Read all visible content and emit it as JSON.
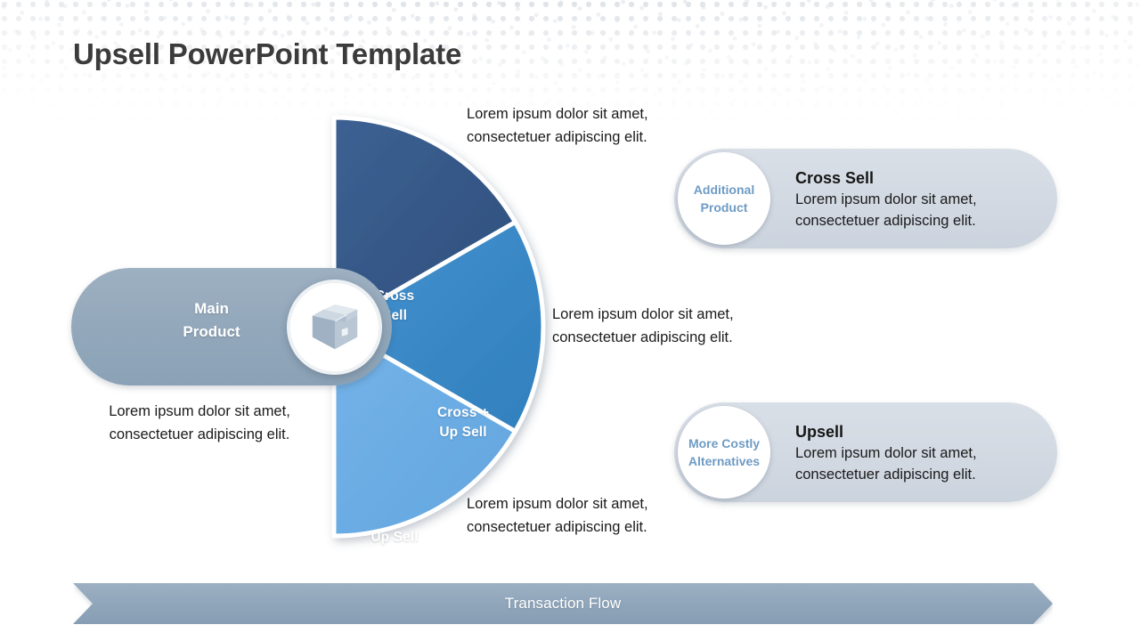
{
  "slide": {
    "title": "Upsell PowerPoint Template",
    "background_pattern": "halftone-dots",
    "colors": {
      "accent_dark_blue": "#3a5e8e",
      "accent_mid_blue": "#3d8dcc",
      "accent_light_blue": "#6fb0e6",
      "pill_gray_blue": "#96abbd",
      "card_gray": "#d3dae3",
      "circle_label_blue": "#6e9bc4",
      "title_color": "#3b3b3b",
      "body_text": "#1a1a1a"
    }
  },
  "diagram": {
    "center_icon_name": "package-box-icon",
    "main_product": {
      "label_line1": "Main",
      "label_line2": "Product",
      "description": "Lorem ipsum dolor sit amet, consectetuer adipiscing elit."
    },
    "wedges": [
      {
        "id": "cross-sell",
        "label_line1": "Cross",
        "label_line2": "Sell",
        "color": "#3a5e8e",
        "description": "Lorem ipsum dolor sit amet, consectetuer adipiscing elit."
      },
      {
        "id": "cross-up-sell",
        "label_line1": "Cross +",
        "label_line2": "Up Sell",
        "color": "#3d8dcc",
        "description": "Lorem ipsum dolor sit amet, consectetuer adipiscing elit."
      },
      {
        "id": "up-sell",
        "label_line1": "Up Sell",
        "label_line2": "",
        "color": "#6fb0e6",
        "description": "Lorem ipsum dolor sit amet, consectetuer adipiscing elit."
      }
    ]
  },
  "side_cards": [
    {
      "id": "cross-sell",
      "badge_line1": "Additional",
      "badge_line2": "Product",
      "title": "Cross Sell",
      "description": "Lorem ipsum dolor sit amet, consectetuer  adipiscing elit."
    },
    {
      "id": "upsell",
      "badge_line1": "More Costly",
      "badge_line2": "Alternatives",
      "title": "Upsell",
      "description": "Lorem ipsum dolor sit amet, consectetuer  adipiscing elit."
    }
  ],
  "footer": {
    "banner_label": "Transaction Flow",
    "banner_shape": "right-chevron-arrow"
  }
}
